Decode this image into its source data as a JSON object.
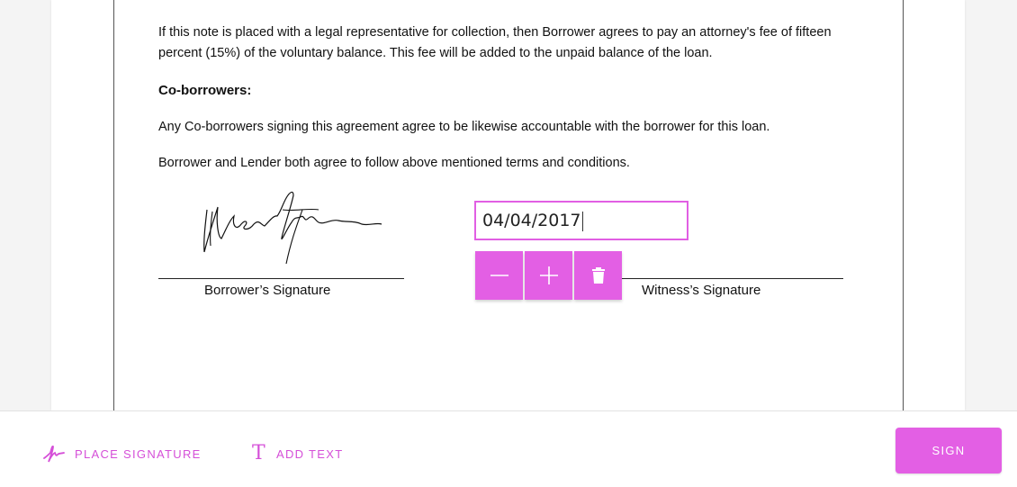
{
  "document": {
    "paragraph1": " If this note is placed with a legal representative for collection, then Borrower agrees to pay an attorney's fee of fifteen percent (15%) of the voluntary balance. This fee will be added to the unpaid balance of the loan.",
    "heading": "Co-borrowers:",
    "paragraph2": "Any Co-borrowers signing this agreement agree to be likewise accountable with the borrower for this loan.",
    "paragraph3": "Borrower and Lender both agree to follow above mentioned terms and conditions.",
    "borrower_label": "Borrower’s Signature",
    "witness_label": "Witness’s Signature"
  },
  "date_field": {
    "value": "04/04/2017"
  },
  "field_toolbar": {
    "buttons": [
      {
        "icon": "minus-icon"
      },
      {
        "icon": "plus-icon"
      },
      {
        "icon": "trash-icon"
      }
    ]
  },
  "bottom_bar": {
    "place_signature": "PLACE SIGNATURE",
    "add_text": "ADD TEXT",
    "sign": "SIGN"
  },
  "colors": {
    "accent": "#e35fe4",
    "accent_text": "#d54fd8"
  }
}
